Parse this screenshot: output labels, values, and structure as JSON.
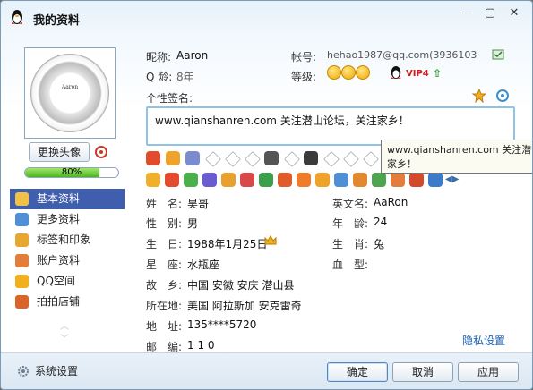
{
  "window": {
    "title": "我的资料"
  },
  "profile": {
    "nickname_label": "昵称:",
    "nickname": "Aaron",
    "account_label": "帐号:",
    "account": "hehao1987@qq.com(3936103",
    "qage_label": "Q 龄:",
    "qage": "8年",
    "level_label": "等级:",
    "vip_label": "VIP4",
    "signature_label": "个性签名:",
    "signature": "www.qianshanren.com 关注潜山论坛，关注家乡！"
  },
  "avatar": {
    "brand_text": "Aaron",
    "change_label": "更换头像",
    "completion": "80%",
    "completion_value": 0.8
  },
  "nav": {
    "items": [
      {
        "label": "基本资料",
        "icon": "card-icon",
        "color": "#f2c14a",
        "active": true
      },
      {
        "label": "更多资料",
        "icon": "list-icon",
        "color": "#4f8fd6",
        "active": false
      },
      {
        "label": "标签和印象",
        "icon": "tag-icon",
        "color": "#e8a733",
        "active": false
      },
      {
        "label": "账户资料",
        "icon": "user-icon",
        "color": "#e27d3c",
        "active": false
      },
      {
        "label": "QQ空间",
        "icon": "star-icon",
        "color": "#f0b11f",
        "active": false
      },
      {
        "label": "拍拍店铺",
        "icon": "shop-icon",
        "color": "#d9652a",
        "active": false
      }
    ],
    "settings_label": "系统设置"
  },
  "details": {
    "name_label": "姓　名:",
    "name": "昊哥",
    "en_label": "英文名:",
    "en_name": "AaRon",
    "gender_label": "性　别:",
    "gender": "男",
    "age_label": "年　龄:",
    "age": "24",
    "birthday_label": "生　日:",
    "birthday": "1988年1月25日",
    "zodiac_label": "生　肖:",
    "zodiac": "兔",
    "star_label": "星　座:",
    "star": "水瓶座",
    "blood_label": "血　型:",
    "blood": "",
    "hometown_label": "故　乡:",
    "hometown": "中国  安徽  安庆  潜山县",
    "location_label": "所在地:",
    "location": "美国  阿拉斯加  安克雷奇",
    "address_label": "地　址:",
    "address": "135****5720",
    "zip_label": "邮　编:",
    "zip": "1 1 0"
  },
  "privacy_label": "隐私设置",
  "tooltip": {
    "line1": "www.qianshanren.com 关注潜",
    "line2": "家乡！"
  },
  "buttons": {
    "ok": "确定",
    "cancel": "取消",
    "apply": "应用"
  },
  "colors": {
    "accent": "#3f5fae",
    "link": "#1a5fb4",
    "vip": "#d21b1b"
  }
}
